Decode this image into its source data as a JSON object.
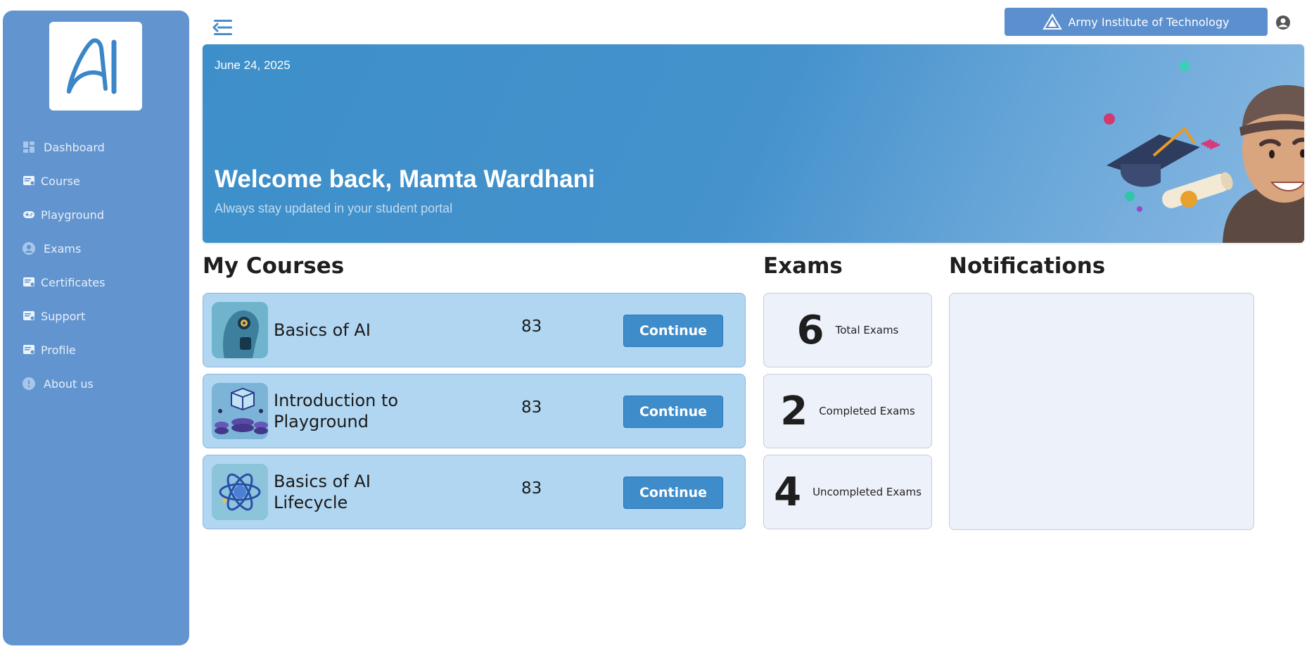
{
  "app": {
    "logo_text": "AI"
  },
  "sidebar": {
    "items": [
      {
        "label": "Dashboard",
        "icon": "dashboard-icon"
      },
      {
        "label": "Course",
        "icon": "course-icon"
      },
      {
        "label": "Playground",
        "icon": "gamepad-icon"
      },
      {
        "label": "Exams",
        "icon": "exam-user-icon"
      },
      {
        "label": "Certificates",
        "icon": "certificate-icon"
      },
      {
        "label": "Support",
        "icon": "support-icon"
      },
      {
        "label": "Profile",
        "icon": "profile-icon"
      },
      {
        "label": "About us",
        "icon": "info-icon"
      }
    ]
  },
  "header": {
    "institute": "Army Institute of Technology"
  },
  "banner": {
    "date": "June 24, 2025",
    "title": "Welcome back, Mamta Wardhani",
    "subtitle": "Always stay updated in your student portal"
  },
  "courses": {
    "title": "My Courses",
    "items": [
      {
        "name": "Basics of AI",
        "score": "83",
        "action": "Continue"
      },
      {
        "name": "Introduction to Playground",
        "score": "83",
        "action": "Continue"
      },
      {
        "name": "Basics of AI Lifecycle",
        "score": "83",
        "action": "Continue"
      }
    ]
  },
  "exams": {
    "title": "Exams",
    "items": [
      {
        "count": "6",
        "label": "Total Exams"
      },
      {
        "count": "2",
        "label": "Completed Exams"
      },
      {
        "count": "4",
        "label": "Uncompleted Exams"
      }
    ]
  },
  "notifications": {
    "title": "Notifications"
  },
  "colors": {
    "sidebar": "#6295cf",
    "primary": "#3f8cca",
    "course_card": "#b1d6f1",
    "panel": "#edf1f9"
  }
}
